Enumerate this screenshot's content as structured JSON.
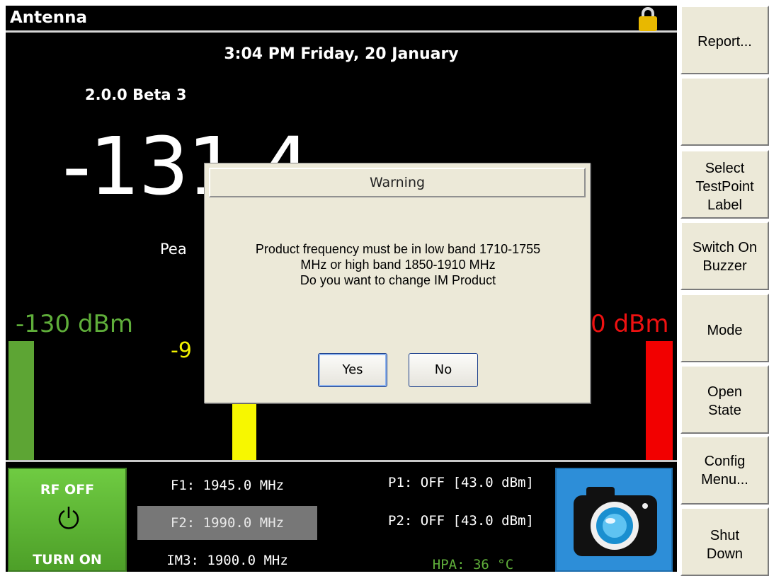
{
  "window": {
    "title": "Antenna"
  },
  "header": {
    "datetime": "3:04 PM Friday, 20 January",
    "version": "2.0.0 Beta 3"
  },
  "main": {
    "reading": "-131.4",
    "peak_label": "Pea",
    "level_left": "-130 dBm",
    "level_right": "0 dBm",
    "level_mid": "-9",
    "colors": {
      "green": "#5da534",
      "yellow": "#f7f700",
      "red": "#f20000"
    }
  },
  "bottom": {
    "rf_button": {
      "top_label": "RF OFF",
      "bottom_label": "TURN ON",
      "icon": "power-icon"
    },
    "f1": "F1: 1945.0 MHz",
    "f2": "F2: 1990.0 MHz",
    "im3": "IM3: 1900.0 MHz",
    "p1": "P1: OFF [43.0 dBm]",
    "p2": "P2: OFF [43.0 dBm]",
    "hpa": "HPA: 36 °C",
    "camera_icon": "camera-icon"
  },
  "dialog": {
    "title": "Warning",
    "line1": "Product frequency must be in low band 1710-1755",
    "line2": "MHz or high band 1850-1910 MHz",
    "line3": "Do you want to change IM Product",
    "yes": "Yes",
    "no": "No"
  },
  "softkeys": [
    {
      "name": "report",
      "lines": [
        "Report..."
      ]
    },
    {
      "name": "blank",
      "lines": []
    },
    {
      "name": "select-testpoint-label",
      "lines": [
        "Select",
        "TestPoint",
        "Label"
      ]
    },
    {
      "name": "switch-on-buzzer",
      "lines": [
        "Switch On",
        "Buzzer"
      ]
    },
    {
      "name": "mode",
      "lines": [
        "Mode"
      ]
    },
    {
      "name": "open-state",
      "lines": [
        "Open",
        "State"
      ]
    },
    {
      "name": "config-menu",
      "lines": [
        "Config",
        "Menu..."
      ]
    },
    {
      "name": "shut-down",
      "lines": [
        "Shut",
        "Down"
      ]
    }
  ]
}
